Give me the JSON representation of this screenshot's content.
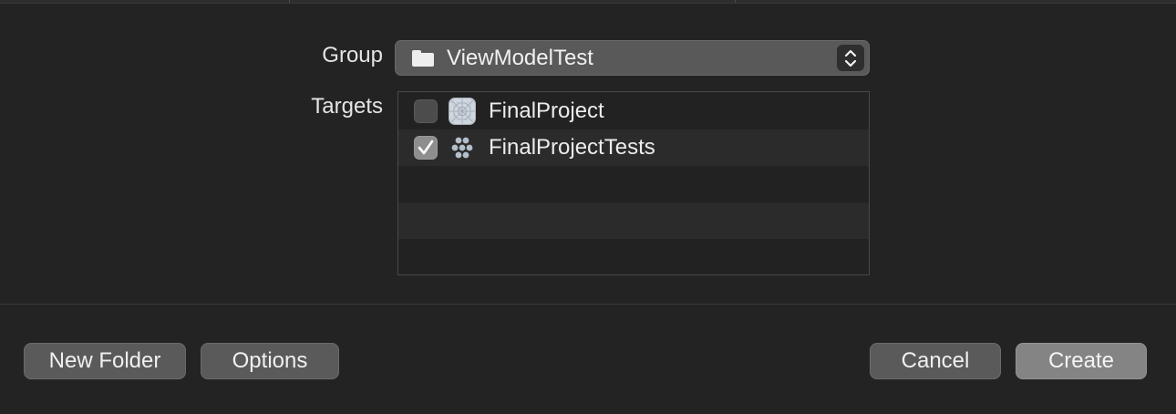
{
  "group": {
    "label": "Group",
    "selected": "ViewModelTest",
    "folder_icon": "folder-icon",
    "stepper_icon": "chevron-up-down-icon"
  },
  "targets": {
    "label": "Targets",
    "items": [
      {
        "name": "FinalProject",
        "checked": false,
        "icon": "app-target-icon"
      },
      {
        "name": "FinalProjectTests",
        "checked": true,
        "icon": "test-bundle-icon"
      }
    ]
  },
  "buttons": {
    "new_folder": "New Folder",
    "options": "Options",
    "cancel": "Cancel",
    "create": "Create"
  },
  "colors": {
    "background": "#242323",
    "popup": "#5a5959",
    "button": "#5b5a5a",
    "primary_button": "#858484",
    "alt_row": "#2c2b2b"
  }
}
